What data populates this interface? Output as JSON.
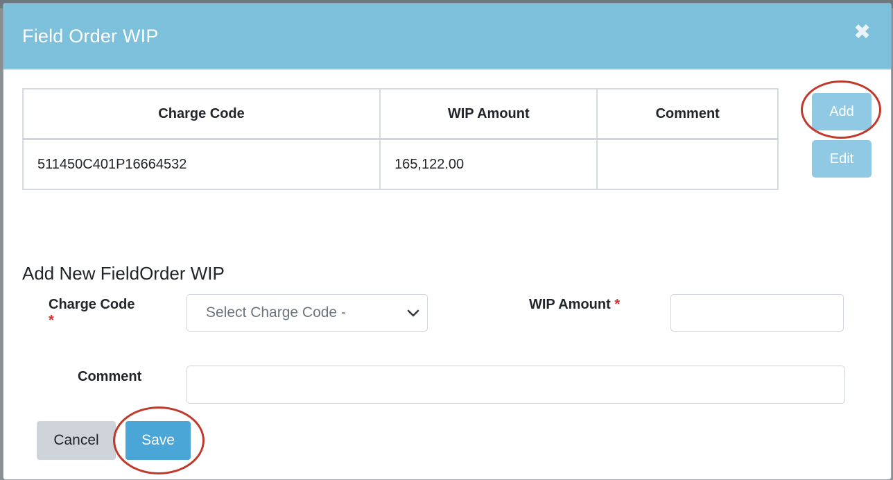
{
  "modal": {
    "title": "Field Order WIP",
    "close_glyph": "✖"
  },
  "table": {
    "headers": [
      "Charge Code",
      "WIP Amount",
      "Comment"
    ],
    "rows": [
      {
        "charge_code": "511450C401P16664532",
        "wip_amount": "165,122.00",
        "comment": ""
      }
    ]
  },
  "side_actions": {
    "add_label": "Add",
    "edit_label": "Edit"
  },
  "form": {
    "section_title": "Add New FieldOrder WIP",
    "charge_code_label": "Charge Code",
    "required_mark": "*",
    "charge_code_placeholder": "Select Charge Code -",
    "wip_amount_label": "WIP Amount",
    "wip_amount_value": "",
    "comment_label": "Comment",
    "comment_value": ""
  },
  "footer": {
    "cancel_label": "Cancel",
    "save_label": "Save"
  },
  "colors": {
    "header_bg": "#7cc0dc",
    "primary_button": "#4aa6d6",
    "light_button": "#8fc9e4",
    "annotation_ring": "#c0392b",
    "required": "#d9302c"
  }
}
